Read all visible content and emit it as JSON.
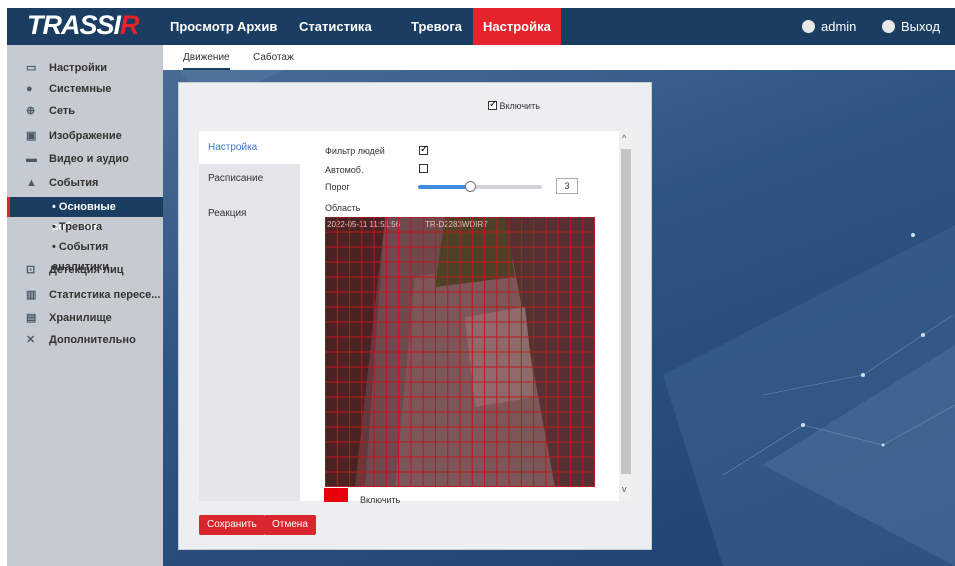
{
  "app": {
    "logo": "TRASSIR",
    "logo_main": "TRASSI",
    "logo_accent": "R"
  },
  "nav": {
    "items": [
      "Просмотр",
      "Архив",
      "Статистика",
      "Тревога",
      "Настройка"
    ],
    "active": "Настройка"
  },
  "header_right": {
    "user": "admin",
    "logout": "Выход",
    "user_icon": "user-icon",
    "logout_icon": "logout-icon"
  },
  "sidebar": {
    "items": [
      {
        "label": "Настройки",
        "icon": "monitor-icon"
      },
      {
        "label": "Системные",
        "icon": "info-icon"
      },
      {
        "label": "Сеть",
        "icon": "globe-icon"
      },
      {
        "label": "Изображение",
        "icon": "image-icon"
      },
      {
        "label": "Видео и аудио",
        "icon": "video-icon"
      },
      {
        "label": "События",
        "icon": "bell-icon"
      },
      {
        "label": "Детекция лиц",
        "icon": "face-icon"
      },
      {
        "label": "Статистика пересе...",
        "icon": "chart-icon"
      },
      {
        "label": "Хранилище",
        "icon": "save-icon"
      },
      {
        "label": "Дополнительно",
        "icon": "tools-icon"
      }
    ],
    "subitems": [
      "• Основные события",
      "• Тревога",
      "• События аналитики"
    ],
    "active_sub": "• Основные события"
  },
  "tabs": {
    "items": [
      "Движение",
      "Саботаж"
    ],
    "active": "Движение"
  },
  "panel": {
    "enable_label": "Включить",
    "enable_checked": true,
    "left_tabs": [
      "Настройка",
      "Расписание",
      "Реакция"
    ],
    "active_left_tab": "Настройка",
    "people_filter_label": "Фильтр людей",
    "people_filter_checked": true,
    "auto_label": "Автомоб.",
    "auto_checked": false,
    "threshold_label": "Порог",
    "threshold_value": "3",
    "threshold_fraction": 0.42,
    "area_label": "Область",
    "osd_timestamp": "2022-05-11 11:51:56",
    "osd_camera": "TR-D2283WDIR7",
    "grid": {
      "cols": 22,
      "rows": 18,
      "color": "#c0171b"
    },
    "bottom_enable_label": "Включить",
    "bottom_enable_color": "#e8000a",
    "save_label": "Сохранить",
    "cancel_label": "Отмена",
    "accent_color": "#d9262e",
    "header_color": "#1a3d61"
  }
}
